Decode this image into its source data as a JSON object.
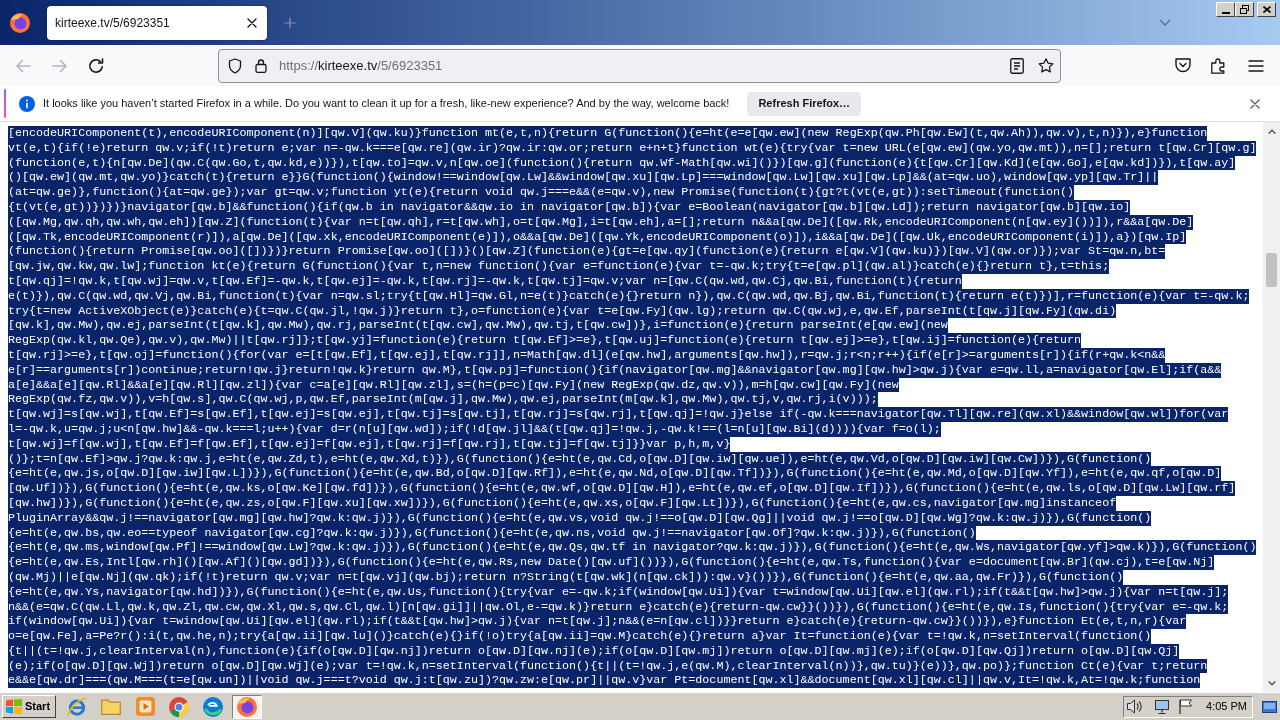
{
  "tabs": [
    {
      "title": "kirteexe.tv/5/6923351",
      "selected": true
    }
  ],
  "nav_buttons": [
    {
      "kind": "back",
      "disabled": true
    },
    {
      "kind": "forward",
      "disabled": true
    },
    {
      "kind": "reload",
      "disabled": false
    }
  ],
  "address_bar": {
    "url": "https://kirteexe.tv/5/6923351",
    "bookmarked": false
  },
  "notification": {
    "message": "It looks like you haven’t started Firefox in a while. Do you want to clean it up for a fresh, like-new experience? And by the way, welcome back!",
    "button": "Refresh Firefox…"
  },
  "code": {
    "selected": true,
    "lines": [
      "[encodeURIComponent(t),encodeURIComponent(n)][qw.V](qw.ku)}function mt(e,t,n){return G(function(){e=ht(e=e[qw.ew](new RegExp(qw.Ph[qw.Ew](t,qw.Ah)),qw.v),t,n)}),e}function",
      "vt(e,t){if(!e)return qw.v;if(!t)return e;var n=-qw.k===e[qw.re](qw.ir)?qw.ir:qw.or;return e+n+t}function wt(e){try{var t=new URL(e[qw.ew](qw.yo,qw.mt)),n=[];return t[qw.Cr][qw.g]",
      "(function(e,t){n[qw.De](qw.C(qw.Go,t,qw.kd,e))}),t[qw.to]=qw.v,n[qw.oe](function(){return qw.Wf-Math[qw.wi]()})[qw.g](function(e){t[qw.Cr][qw.Kd](e[qw.Go],e[qw.kd])}),t[qw.ay]",
      "()[qw.ew](qw.mt,qw.yo)}catch(t){return e}}G(function(){window!==window[qw.Lw]&&window[qw.xu][qw.Lp]===window[qw.Lw][qw.xu][qw.Lp]&&(at=qw.uo),window[qw.yp][qw.Tr]||",
      "(at=qw.ge)},function(){at=qw.ge});var gt=qw.v;function yt(e){return void qw.j===e&&(e=qw.v),new Promise(function(t){gt?t(vt(e,gt)):setTimeout(function()",
      "{t(vt(e,gt))})})}navigator[qw.b]&&function(){if(qw.b in navigator&&qw.io in navigator[qw.b]){var e=Boolean(navigator[qw.b][qw.Ld]);return navigator[qw.b][qw.io]",
      "([qw.Mg,qw.qh,qw.wh,qw.eh])[qw.Z](function(t){var n=t[qw.qh],r=t[qw.wh],o=t[qw.Mg],i=t[qw.eh],a=[];return n&&a[qw.De]([qw.Rk,encodeURIComponent(n[qw.ey]())]),r&&a[qw.De]",
      "([qw.Tk,encodeURIComponent(r)]),a[qw.De]([qw.xk,encodeURIComponent(e)]),o&&a[qw.De]([qw.Yk,encodeURIComponent(o)]),i&&a[qw.De]([qw.Uk,encodeURIComponent(i)]),a})[qw.Ip]",
      "(function(){return Promise[qw.oo]([])})}return Promise[qw.oo]([])}()[qw.Z](function(e){gt=e[qw.qy](function(e){return e[qw.V](qw.ku)})[qw.V](qw.or)});var St=qw.n,bt=",
      "[qw.jw,qw.kw,qw.lw];function kt(e){return G(function(){var t,n=new function(){var e=function(e){var t=-qw.k;try{t=e[qw.pl](qw.al)}catch(e){}return t},t=this;",
      "t[qw.qj]=!qw.k,t[qw.wj]=qw.v,t[qw.Ef]=-qw.k,t[qw.ej]=-qw.k,t[qw.rj]=-qw.k,t[qw.tj]=qw.v;var n=[qw.C(qw.wd,qw.Cj,qw.Bi,function(t){return",
      "e(t)}),qw.C(qw.wd,qw.Vj,qw.Bi,function(t){var n=qw.sl;try{t[qw.Hl]=qw.Gl,n=e(t)}catch(e){}return n}),qw.C(qw.wd,qw.Bj,qw.Bi,function(t){return e(t)})],r=function(e){var t=-qw.k;",
      "try{t=new ActiveXObject(e)}catch(e){t=qw.C(qw.jl,!qw.j)}return t},o=function(e){var t=e[qw.Fy](qw.lg);return qw.C(qw.wj,e,qw.Ef,parseInt(t[qw.j][qw.Fy](qw.di)",
      "[qw.k],qw.Mw),qw.ej,parseInt(t[qw.k],qw.Mw),qw.rj,parseInt(t[qw.cw],qw.Mw),qw.tj,t[qw.cw])},i=function(e){return parseInt(e[qw.ew](new",
      "RegExp(qw.kl,qw.Qe),qw.v),qw.Mw)||t[qw.rj]};t[qw.yj]=function(e){return t[qw.Ef]>=e},t[qw.uj]=function(e){return t[qw.ej]>=e},t[qw.ij]=function(e){return",
      "t[qw.rj]>=e},t[qw.oj]=function(){for(var e=[t[qw.Ef],t[qw.ej],t[qw.rj]],n=Math[qw.dl](e[qw.hw],arguments[qw.hw]),r=qw.j;r<n;r++){if(e[r]>=arguments[r]){if(r+qw.k<n&&",
      "e[r]==arguments[r])continue;return!qw.j}return!qw.k}return qw.M},t[qw.pj]=function(){if(navigator[qw.mg]&&navigator[qw.mg][qw.hw]>qw.j){var e=qw.ll,a=navigator[qw.El];if(a&&",
      "a[e]&&a[e][qw.Rl]&&a[e][qw.Rl][qw.zl]){var c=a[e][qw.Rl][qw.zl],s=(h=(p=c)[qw.Fy](new RegExp(qw.dz,qw.v)),m=h[qw.cw][qw.Fy](new",
      "RegExp(qw.fz,qw.v)),v=h[qw.s],qw.C(qw.wj,p,qw.Ef,parseInt(m[qw.j],qw.Mw),qw.ej,parseInt(m[qw.k],qw.Mw),qw.tj,v,qw.rj,i(v)));",
      "t[qw.wj]=s[qw.wj],t[qw.Ef]=s[qw.Ef],t[qw.ej]=s[qw.ej],t[qw.tj]=s[qw.tj],t[qw.rj]=s[qw.rj],t[qw.qj]=!qw.j}else if(-qw.k===navigator[qw.Tl][qw.re](qw.xl)&&window[qw.wl])for(var",
      "l=-qw.k,u=qw.j;u<n[qw.hw]&&-qw.k===l;u++){var d=r(n[u][qw.wd]);if(!d[qw.jl]&&(t[qw.qj]=!qw.j,-qw.k!==(l=n[u][qw.Bi](d)))){var f=o(l);",
      "t[qw.wj]=f[qw.wj],t[qw.Ef]=f[qw.Ef],t[qw.ej]=f[qw.ej],t[qw.rj]=f[qw.rj],t[qw.tj]=f[qw.tj]}}var p,h,m,v}",
      "()};t=n[qw.Ef]>qw.j?qw.k:qw.j,e=ht(e,qw.Zd,t),e=ht(e,qw.Xd,t)}),G(function(){e=ht(e,qw.Cd,o[qw.D][qw.iw][qw.ue]),e=ht(e,qw.Vd,o[qw.D][qw.iw][qw.Cw])}),G(function()",
      "{e=ht(e,qw.js,o[qw.D][qw.iw][qw.L])}),G(function(){e=ht(e,qw.Bd,o[qw.D][qw.Rf]),e=ht(e,qw.Nd,o[qw.D][qw.Tf])}),G(function(){e=ht(e,qw.Md,o[qw.D][qw.Yf]),e=ht(e,qw.qf,o[qw.D]",
      "[qw.Uf])}),G(function(){e=ht(e,qw.ks,o[qw.Ke][qw.fd])}),G(function(){e=ht(e,qw.wf,o[qw.D][qw.H]),e=ht(e,qw.ef,o[qw.D][qw.If])}),G(function(){e=ht(e,qw.ls,o[qw.D][qw.Lw][qw.rf]",
      "[qw.hw])}),G(function(){e=ht(e,qw.zs,o[qw.F][qw.xu][qw.xw])}),G(function(){e=ht(e,qw.xs,o[qw.F][qw.Lt])}),G(function(){e=ht(e,qw.cs,navigator[qw.mg]instanceof",
      "PluginArray&&qw.j!==navigator[qw.mg][qw.hw]?qw.k:qw.j)}),G(function(){e=ht(e,qw.vs,void qw.j!==o[qw.D][qw.Qg]||void qw.j!==o[qw.D][qw.Wg]?qw.k:qw.j)}),G(function()",
      "{e=ht(e,qw.bs,qw.eo==typeof navigator[qw.cg]?qw.k:qw.j)}),G(function(){e=ht(e,qw.ns,void qw.j!==navigator[qw.Of]?qw.k:qw.j)}),G(function()",
      "{e=ht(e,qw.ms,window[qw.Pf]!==window[qw.Lw]?qw.k:qw.j)}),G(function(){e=ht(e,qw.Qs,qw.tf in navigator?qw.k:qw.j)}),G(function(){e=ht(e,qw.Ws,navigator[qw.yf]>qw.k)}),G(function()",
      "{e=ht(e,qw.Es,Intl[qw.rh]()[qw.Af]()[qw.gd])}),G(function(){e=ht(e,qw.Rs,new Date()[qw.uf]())}),G(function(){e=ht(e,qw.Ts,function(){var e=document[qw.Br](qw.cj),t=e[qw.Nj]",
      "(qw.Mj)||e[qw.Nj](qw.qk);if(!t)return qw.v;var n=t[qw.vj](qw.bj);return n?String(t[qw.wk](n[qw.ck])):qw.v}())}),G(function(){e=ht(e,qw.aa,qw.Fr)}),G(function()",
      "{e=ht(e,qw.Ys,navigator[qw.hd])}),G(function(){e=ht(e,qw.Us,function(){try{var e=-qw.k;if(window[qw.Ui]){var t=window[qw.Ui][qw.el](qw.rl);if(t&&t[qw.hw]>qw.j){var n=t[qw.j];",
      "n&&(e=qw.C(qw.Ll,qw.k,qw.Zl,qw.cw,qw.Xl,qw.s,qw.Cl,qw.l)[n[qw.gi]]||qw.Ol,e-=qw.k)}return e}catch(e){return-qw.cw}}())}),G(function(){e=ht(e,qw.Is,function(){try{var e=-qw.k;",
      "if(window[qw.Ui]){var t=window[qw.Ui][qw.el](qw.rl);if(t&&t[qw.hw]>qw.j){var n=t[qw.j];n&&(e=n[qw.cl])}}return e}catch(e){return-qw.cw}}())}),e}function Et(e,t,n,r){var",
      "o=e[qw.Fe],a=Pe?r():i(t,qw.he,n);try{a[qw.ii][qw.lu]()}catch(e){}if(!o)try{a[qw.ii]=qw.M}catch(e){}return a}var It=function(e){var t=!qw.k,n=setInterval(function()",
      "{t||(t=!qw.j,clearInterval(n),function(e){if(o[qw.D][qw.nj])return o[qw.D][qw.nj](e);if(o[qw.D][qw.mj])return o[qw.D][qw.mj](e);if(o[qw.D][qw.Qj])return o[qw.D][qw.Qj]",
      "(e);if(o[qw.D][qw.Wj])return o[qw.D][qw.Wj](e);var t=!qw.k,n=setInterval(function(){t||(t=!qw.j,e(qw.M),clearInterval(n))},qw.tu)}(e))},qw.po)};function Ct(e){var t;return",
      "e&&e[qw.dr]===(qw.M===(t=e[qw.un])||void qw.j===t?void qw.j:t[qw.zu])?qw.zw:e[qw.pr]||qw.v}var Pt=document[qw.xl]&&document[qw.xl][qw.cl]||qw.v,It=!qw.k,At=!qw.k;function"
    ]
  },
  "taskbar": {
    "start_label": "Start",
    "quick_launch": [
      {
        "kind": "ie",
        "selected": false
      },
      {
        "kind": "explorer",
        "selected": false
      },
      {
        "kind": "media",
        "selected": false
      },
      {
        "kind": "chrome",
        "selected": false
      },
      {
        "kind": "edge",
        "selected": false
      },
      {
        "kind": "firefox",
        "selected": true
      }
    ],
    "clock": "4:05 PM"
  }
}
